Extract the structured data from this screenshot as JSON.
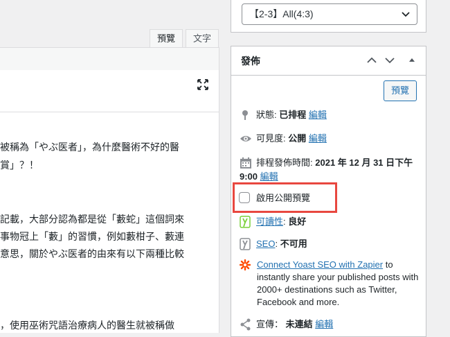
{
  "tabs": {
    "visual": "預覽",
    "text": "文字"
  },
  "content_lines": [
    "被稱為「やぶ医者」，為什麼醫術不好的醫",
    "賞」？！",
    "記載，大部分認為都是從「藪蛇」這個詞來",
    "事物冠上「藪」的習慣，例如藪柑子、藪連",
    "意思，關於やぶ医者的由來有以下兩種比較",
    "，使用巫術咒語治療病人的醫生就被稱做"
  ],
  "top_select": {
    "value": "【2-3】All(4:3)"
  },
  "publish": {
    "title": "發佈",
    "preview_button": "預覽",
    "status_label": "狀態:",
    "status_value": "已排程",
    "status_edit": "編輯",
    "visibility_label": "可見度:",
    "visibility_value": "公開",
    "visibility_edit": "編輯",
    "schedule_label": "排程發佈時間:",
    "schedule_value": "2021 年 12 月 31 日下午",
    "schedule_time": "9:00",
    "schedule_edit": "編輯",
    "public_preview_label": "啟用公開預覽",
    "readability_link": "可讀性",
    "readability_value": "良好",
    "seo_link": "SEO",
    "seo_value": "不可用",
    "zapier_link": "Connect Yoast SEO with Zapier",
    "zapier_text": " to instantly share your published posts with 2000+ destinations such as Twitter, Facebook and more.",
    "share_label": "宣傳：",
    "share_value": "未連結",
    "share_edit": "編輯"
  },
  "colors": {
    "accent": "#2271b1",
    "highlight": "#e8473f",
    "yoast_green": "#7ad03a",
    "zapier_orange": "#ff4a00"
  }
}
